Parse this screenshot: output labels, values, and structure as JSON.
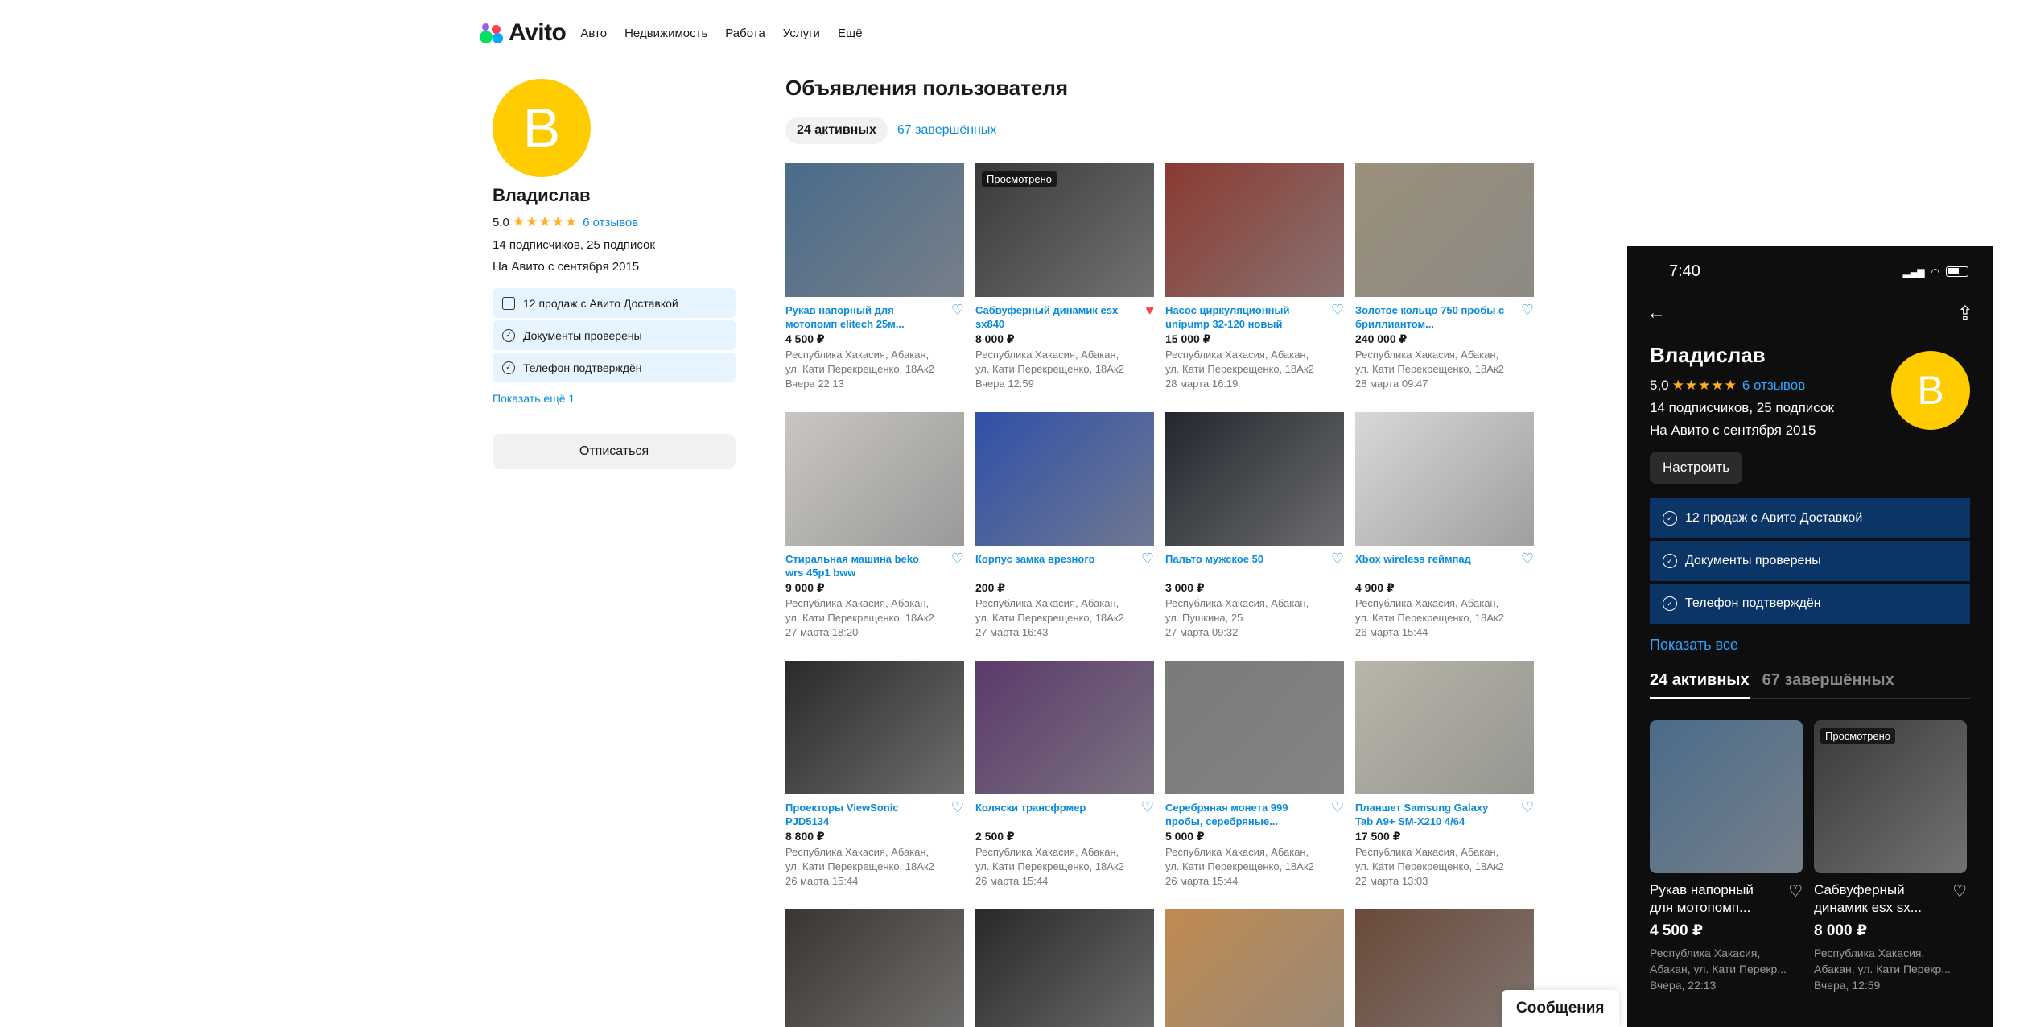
{
  "header": {
    "logo_text": "Avito",
    "nav": [
      "Авто",
      "Недвижимость",
      "Работа",
      "Услуги",
      "Ещё"
    ]
  },
  "profile": {
    "avatar_letter": "В",
    "name": "Владислав",
    "rating": "5,0",
    "reviews": "6 отзывов",
    "subscribers": "14 подписчиков, 25 подписок",
    "since": "На Авито с сентября 2015",
    "badges": [
      "12 продаж с Авито Доставкой",
      "Документы проверены",
      "Телефон подтверждён"
    ],
    "show_more": "Показать ещё 1",
    "unsubscribe": "Отписаться"
  },
  "main": {
    "title": "Объявления пользователя",
    "tab_active": "24 активных",
    "tab_finished": "67 завершённых",
    "seen_label": "Просмотрено",
    "listings": [
      {
        "title": "Рукав напорный для мотопомп elitech 25м...",
        "price": "4 500 ₽",
        "addr1": "Республика Хакасия, Абакан,",
        "addr2": "ул. Кати Перекрещенко, 18Ак2",
        "date": "Вчера 22:13",
        "fav": false,
        "seen": false,
        "color": "#4a6b8a"
      },
      {
        "title": "Сабвуферный динамик esx sx840",
        "price": "8 000 ₽",
        "addr1": "Республика Хакасия, Абакан,",
        "addr2": "ул. Кати Перекрещенко, 18Ак2",
        "date": "Вчера 12:59",
        "fav": true,
        "seen": true,
        "color": "#3a3a3a"
      },
      {
        "title": "Насос циркуляционный unipump 32-120 новый",
        "price": "15 000 ₽",
        "addr1": "Республика Хакасия, Абакан,",
        "addr2": "ул. Кати Перекрещенко, 18Ак2",
        "date": "28 марта 16:19",
        "fav": false,
        "seen": false,
        "color": "#8a3a32"
      },
      {
        "title": "Золотое кольцо 750 пробы с бриллиантом...",
        "price": "240 000 ₽",
        "addr1": "Республика Хакасия, Абакан,",
        "addr2": "ул. Кати Перекрещенко, 18Ак2",
        "date": "28 марта 09:47",
        "fav": false,
        "seen": false,
        "color": "#9a8f7a"
      },
      {
        "title": "Стиральная машина beko wrs 45p1 bww",
        "price": "9 000 ₽",
        "addr1": "Республика Хакасия, Абакан,",
        "addr2": "ул. Кати Перекрещенко, 18Ак2",
        "date": "27 марта 18:20",
        "fav": false,
        "seen": false,
        "color": "#c9c6c2"
      },
      {
        "title": "Корпус замка врезного",
        "price": "200 ₽",
        "addr1": "Республика Хакасия, Абакан,",
        "addr2": "ул. Кати Перекрещенко, 18Ак2",
        "date": "27 марта 16:43",
        "fav": false,
        "seen": false,
        "color": "#3050a8"
      },
      {
        "title": "Пальто мужское 50",
        "price": "3 000 ₽",
        "addr1": "Республика Хакасия, Абакан,",
        "addr2": "ул. Пушкина, 25",
        "date": "27 марта 09:32",
        "fav": false,
        "seen": false,
        "color": "#23272e"
      },
      {
        "title": "Xbox wireless геймпад",
        "price": "4 900 ₽",
        "addr1": "Республика Хакасия, Абакан,",
        "addr2": "ул. Кати Перекрещенко, 18Ак2",
        "date": "26 марта 15:44",
        "fav": false,
        "seen": false,
        "color": "#d8d8d8"
      },
      {
        "title": "Проекторы ViewSonic PJD5134",
        "price": "8 800 ₽",
        "addr1": "Республика Хакасия, Абакан,",
        "addr2": "ул. Кати Перекрещенко, 18Ак2",
        "date": "26 марта 15:44",
        "fav": false,
        "seen": false,
        "color": "#2a2a2a"
      },
      {
        "title": "Коляски трансфрмер",
        "price": "2 500 ₽",
        "addr1": "Республика Хакасия, Абакан,",
        "addr2": "ул. Кати Перекрещенко, 18Ак2",
        "date": "26 марта 15:44",
        "fav": false,
        "seen": false,
        "color": "#5a3a6a"
      },
      {
        "title": "Серебряная монета 999 пробы, серебряные...",
        "price": "5 000 ₽",
        "addr1": "Республика Хакасия, Абакан,",
        "addr2": "ул. Кати Перекрещенко, 18Ак2",
        "date": "26 марта 15:44",
        "fav": false,
        "seen": false,
        "color": "#7a7a78"
      },
      {
        "title": "Планшет Samsung Galaxy Tab A9+ SM-X210 4/64",
        "price": "17 500 ₽",
        "addr1": "Республика Хакасия, Абакан,",
        "addr2": "ул. Кати Перекрещенко, 18Ак2",
        "date": "22 марта 13:03",
        "fav": false,
        "seen": false,
        "color": "#b8b6a8"
      },
      {
        "title": "",
        "price": "",
        "addr1": "",
        "addr2": "",
        "date": "",
        "fav": false,
        "seen": false,
        "color": "#3a3530"
      },
      {
        "title": "",
        "price": "",
        "addr1": "",
        "addr2": "",
        "date": "",
        "fav": false,
        "seen": false,
        "color": "#2a2828"
      },
      {
        "title": "",
        "price": "",
        "addr1": "",
        "addr2": "",
        "date": "",
        "fav": false,
        "seen": false,
        "color": "#c08a50"
      },
      {
        "title": "",
        "price": "",
        "addr1": "",
        "addr2": "",
        "date": "",
        "fav": false,
        "seen": false,
        "color": "#6a4a3a"
      }
    ]
  },
  "phone": {
    "time": "7:40",
    "name": "Владислав",
    "rating": "5,0",
    "reviews": "6 отзывов",
    "subscribers": "14 подписчиков, 25 подписок",
    "since": "На Авито с сентября 2015",
    "avatar_letter": "В",
    "configure": "Настроить",
    "badges": [
      "12 продаж с Авито Доставкой",
      "Документы проверены",
      "Телефон подтверждён"
    ],
    "show_all": "Показать все",
    "tab_active": "24 активных",
    "tab_finished": "67 завершённых",
    "seen_label": "Просмотрено",
    "cards": [
      {
        "title": "Рукав напорный для мотопомп...",
        "price": "4 500 ₽",
        "addr1": "Республика Хакасия,",
        "addr2": "Абакан, ул. Кати Перекр...",
        "date": "Вчера, 22:13",
        "color": "#4a6b8a",
        "seen": false
      },
      {
        "title": "Сабвуферный динамик esx sx...",
        "price": "8 000 ₽",
        "addr1": "Республика Хакасия,",
        "addr2": "Абакан, ул. Кати Перекр...",
        "date": "Вчера, 12:59",
        "color": "#3a3a3a",
        "seen": true
      }
    ]
  },
  "messages_label": "Сообщения"
}
